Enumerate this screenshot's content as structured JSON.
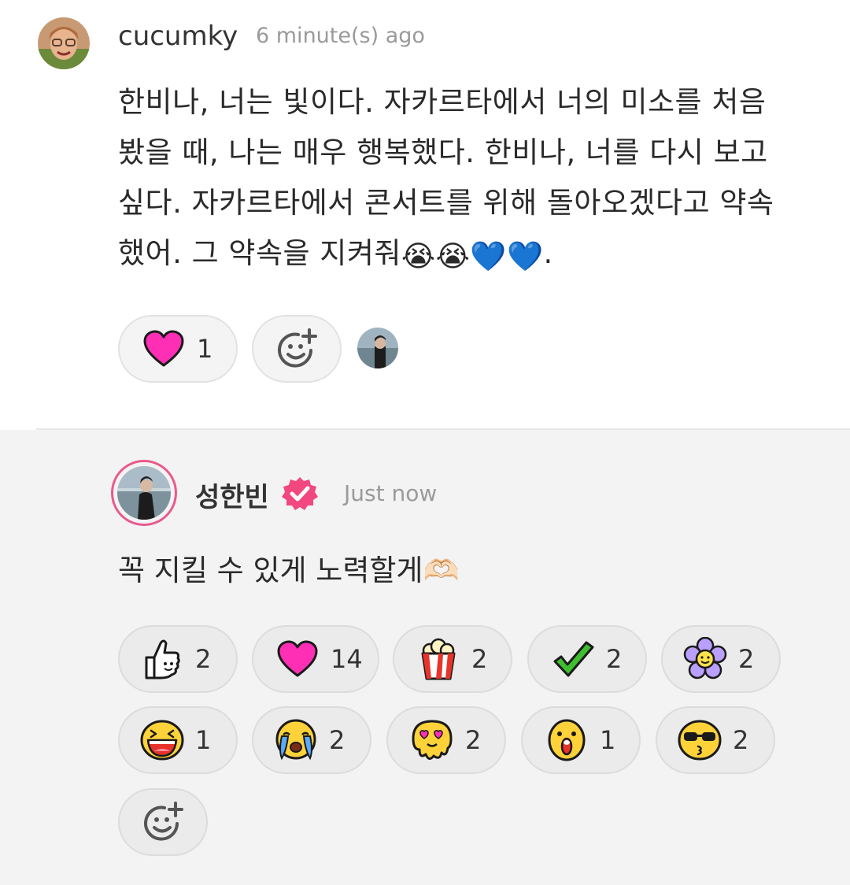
{
  "comment": {
    "username": "cucumky",
    "time": "6 minute(s) ago",
    "text_lines": [
      "한비나, 너는 빛이다. 자카르타에서 너의 미소를 처음",
      "봤을 때, 나는 매우 행복했다. 한비나, 너를 다시 보고",
      "싶다. 자카르타에서 콘서트를 위해 돌아오겠다고 약속",
      "했어. 그 약속을 지켜줘"
    ],
    "text_tail_emojis": [
      "😭",
      "😭",
      "💙",
      "💙"
    ],
    "text_end": ".",
    "reactions": [
      {
        "icon": "heart-icon",
        "count": "1"
      }
    ]
  },
  "reply": {
    "artist_name": "성한빈",
    "time": "Just now",
    "text": "꼭 지킬 수 있게 노력할게🫶🏻",
    "reactions": [
      {
        "icon": "thumbs-up-icon",
        "count": "2"
      },
      {
        "icon": "heart-icon",
        "count": "14"
      },
      {
        "icon": "popcorn-icon",
        "count": "2"
      },
      {
        "icon": "checkmark-icon",
        "count": "2"
      },
      {
        "icon": "flower-icon",
        "count": "2"
      },
      {
        "icon": "laughing-face-icon",
        "count": "1"
      },
      {
        "icon": "crying-face-icon",
        "count": "2"
      },
      {
        "icon": "heart-eyes-melting-icon",
        "count": "2"
      },
      {
        "icon": "surprised-face-icon",
        "count": "1"
      },
      {
        "icon": "sunglasses-kiss-icon",
        "count": "2"
      }
    ]
  },
  "colors": {
    "heart": "#ff2fb5",
    "verified": "#f2477f",
    "artist_ring": "#e95a8d",
    "time": "#9a9a9a",
    "reply_bg": "#f3f3f3"
  }
}
